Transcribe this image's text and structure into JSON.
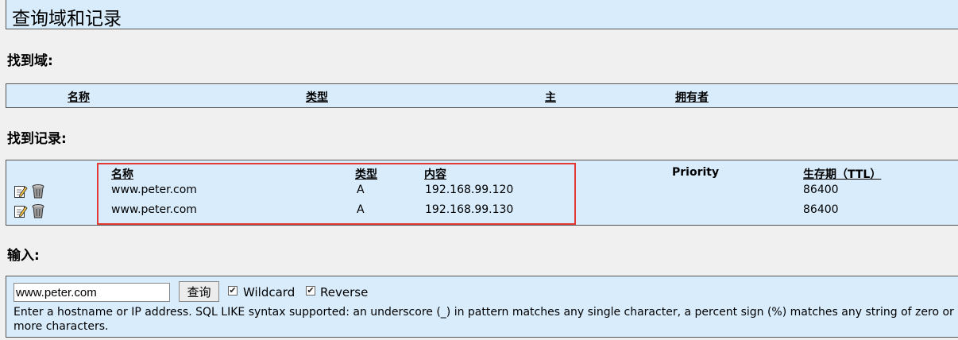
{
  "page": {
    "title": "查询域和记录"
  },
  "domains": {
    "section_title": "找到域:",
    "columns": {
      "name": "名称",
      "type": "类型",
      "master": "主",
      "owner": "拥有者"
    }
  },
  "records": {
    "section_title": "找到记录:",
    "columns": {
      "name": "名称",
      "type": "类型",
      "content": "内容",
      "priority": "Priority",
      "ttl": "生存期（TTL）"
    },
    "rows": [
      {
        "name": "www.peter.com",
        "type": "A",
        "content": "192.168.99.120",
        "priority": "",
        "ttl": "86400"
      },
      {
        "name": "www.peter.com",
        "type": "A",
        "content": "192.168.99.130",
        "priority": "",
        "ttl": "86400"
      }
    ],
    "icons": {
      "edit": "edit-icon",
      "delete": "trash-icon"
    },
    "highlight_color": "#e53935"
  },
  "input": {
    "section_title": "输入:",
    "search_value": "www.peter.com",
    "search_button": "查询",
    "wildcard_label": "Wildcard",
    "wildcard_checked": true,
    "reverse_label": "Reverse",
    "reverse_checked": true,
    "help_text": "Enter a hostname or IP address. SQL LIKE syntax supported: an underscore (_) in pattern matches any single character, a percent sign (%) matches any string of zero or more characters."
  },
  "colors": {
    "panel_bg": "#d8ecfc",
    "page_bg": "#f0f0f0"
  }
}
